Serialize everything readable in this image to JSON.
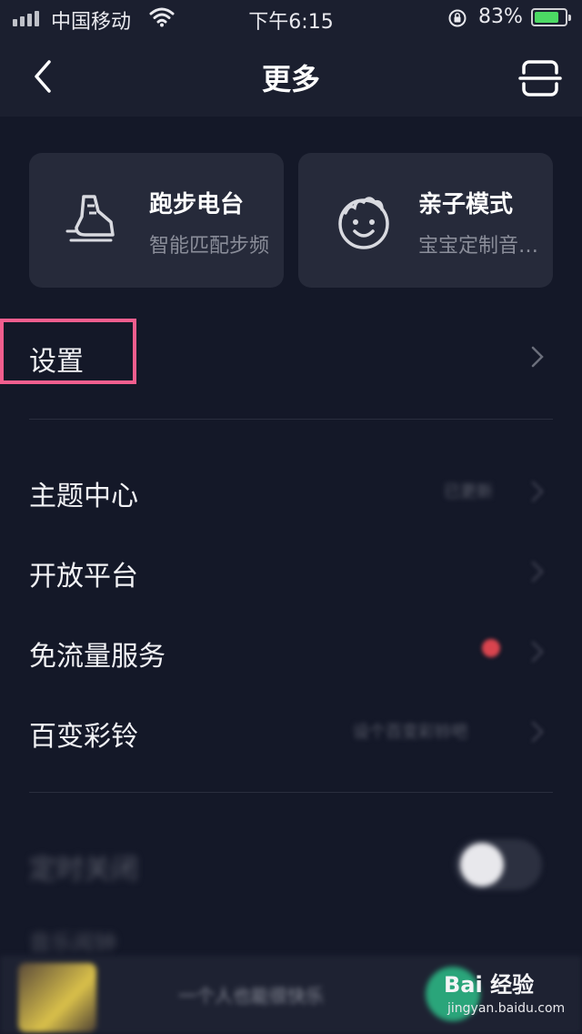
{
  "status_bar": {
    "carrier": "中国移动",
    "time": "下午6:15",
    "battery_percent": "83%",
    "battery_level": 0.83,
    "icons": [
      "signal-icon",
      "wifi-icon",
      "rotation-lock-icon",
      "battery-icon"
    ]
  },
  "nav": {
    "title": "更多",
    "back_icon": "back-arrow-icon",
    "scan_icon": "scan-icon"
  },
  "cards": [
    {
      "title": "跑步电台",
      "subtitle": "智能匹配步频",
      "icon": "running-shoe-icon"
    },
    {
      "title": "亲子模式",
      "subtitle": "宝宝定制音…",
      "icon": "baby-face-icon"
    }
  ],
  "menu_group1": [
    {
      "label": "设置",
      "highlighted": true
    }
  ],
  "menu_group2": [
    {
      "label": "主题中心",
      "extra": "已更新"
    },
    {
      "label": "开放平台",
      "extra": ""
    },
    {
      "label": "免流量服务",
      "badge": "red-dot"
    },
    {
      "label": "百变彩铃",
      "extra": "设个百变彩铃吧"
    }
  ],
  "menu_group3": [
    {
      "label": "定时关闭",
      "toggle": true
    },
    {
      "label": "音乐闹钟"
    }
  ],
  "player": {
    "song": "一个人也能很快乐"
  },
  "watermark": {
    "logo": "Bai 经验",
    "url": "jingyan.baidu.com"
  },
  "colors": {
    "background": "#141828",
    "card": "#262a3a",
    "highlight": "#f25e8e",
    "accent_green": "#4cd964"
  }
}
